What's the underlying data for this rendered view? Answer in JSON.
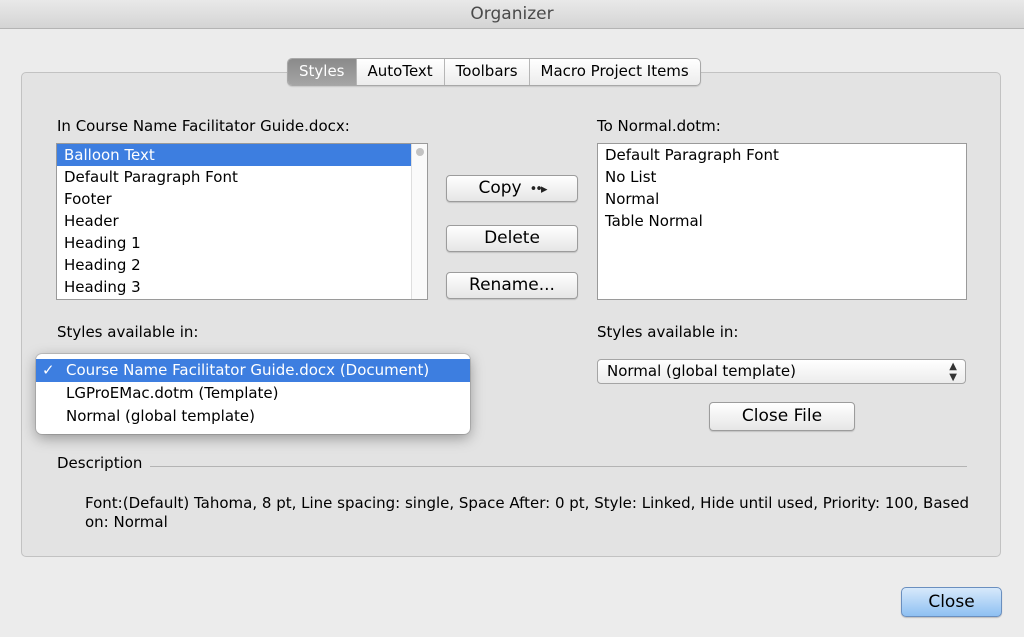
{
  "window": {
    "title": "Organizer"
  },
  "tabs": [
    {
      "label": "Styles",
      "active": true
    },
    {
      "label": "AutoText",
      "active": false
    },
    {
      "label": "Toolbars",
      "active": false
    },
    {
      "label": "Macro Project Items",
      "active": false
    }
  ],
  "left": {
    "label": "In Course Name Facilitator Guide.docx:",
    "items": [
      "Balloon Text",
      "Default Paragraph Font",
      "Footer",
      "Header",
      "Heading 1",
      "Heading 2",
      "Heading 3"
    ],
    "selected": "Balloon Text",
    "available_label": "Styles available in:",
    "dropdown_options": [
      "Course Name Facilitator Guide.docx (Document)",
      "LGProEMac.dotm (Template)",
      "Normal (global template)"
    ],
    "dropdown_selected": "Course Name Facilitator Guide.docx (Document)",
    "check_glyph": "✓"
  },
  "actions": {
    "copy_label": "Copy",
    "copy_arrow": "••▸",
    "delete_label": "Delete",
    "rename_label": "Rename..."
  },
  "right": {
    "label": "To Normal.dotm:",
    "items": [
      "Default Paragraph Font",
      "No List",
      "Normal",
      "Table Normal"
    ],
    "available_label": "Styles available in:",
    "popup_value": "Normal (global template)",
    "popup_glyph": "▲▼",
    "close_file_label": "Close File"
  },
  "description": {
    "label": "Description",
    "text": "Font:(Default) Tahoma, 8 pt, Line spacing:  single, Space After:  0 pt, Style: Linked, Hide until used, Priority: 100, Based on: Normal"
  },
  "footer": {
    "close_label": "Close"
  },
  "colors": {
    "selection": "#3d7ee0",
    "default_button": "#8ec0f2"
  }
}
